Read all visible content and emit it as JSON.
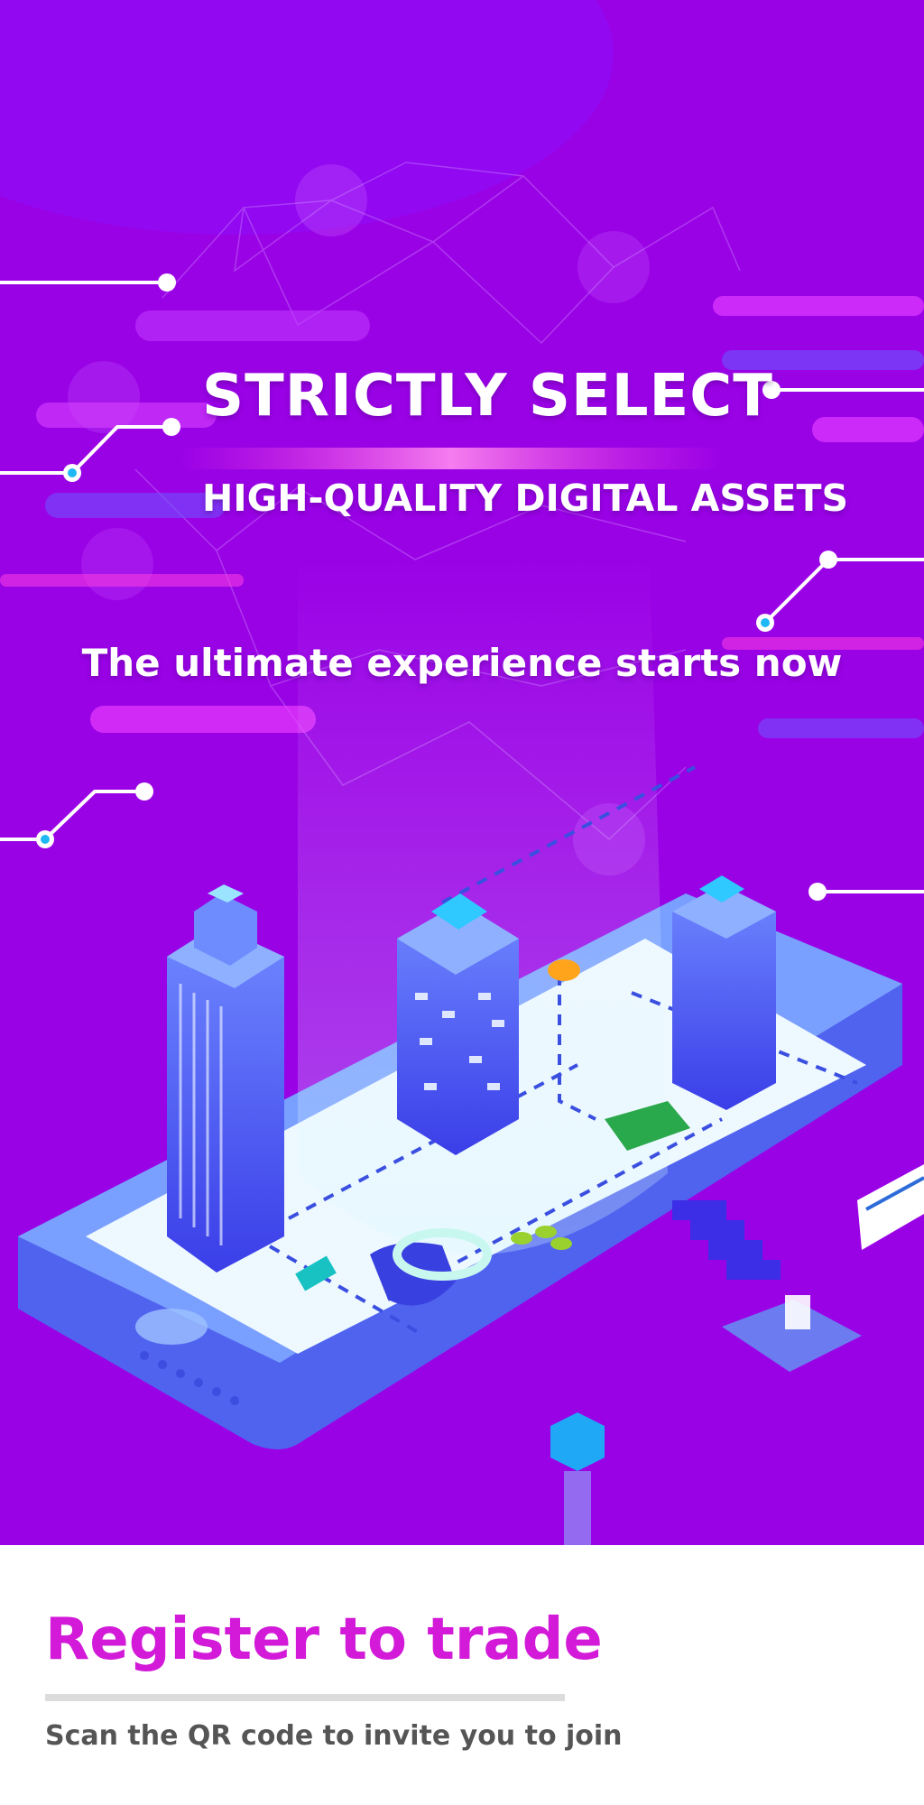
{
  "hero": {
    "headline": "STRICTLY SELECT",
    "subheadline": "HIGH-QUALITY DIGITAL ASSETS",
    "tagline": "The ultimate experience starts now"
  },
  "footer": {
    "cta_title": "Register to trade",
    "cta_subtitle": "Scan the QR code to invite you to join"
  },
  "colors": {
    "background": "#9a02e6",
    "accent": "#d21ad8",
    "building": "#4a5df5",
    "node": "#1fb8f5"
  }
}
